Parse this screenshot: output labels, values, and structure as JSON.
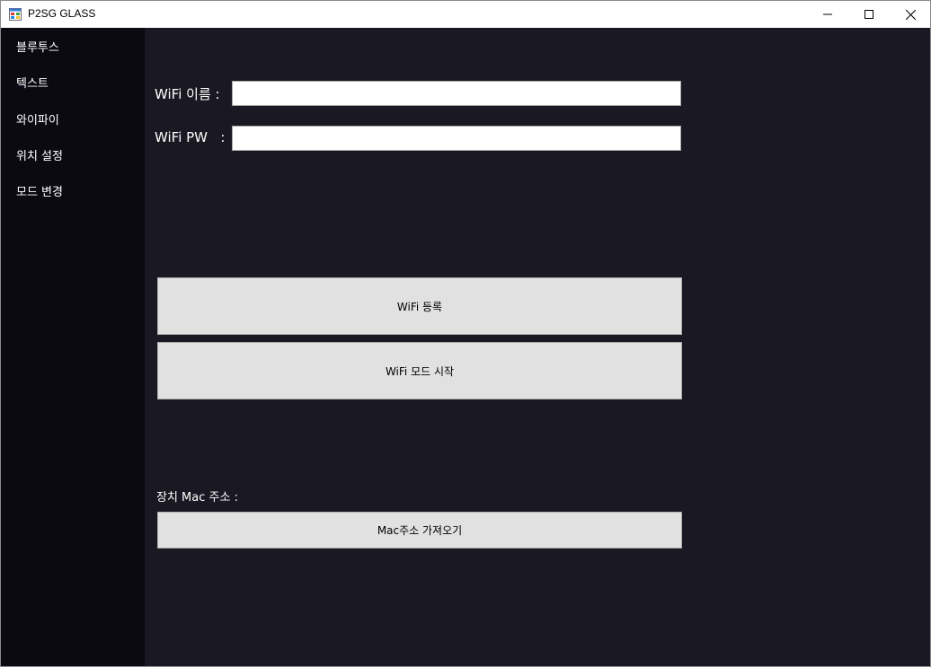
{
  "window": {
    "title": "P2SG GLASS",
    "icon": "app-window-icon",
    "controls": [
      "minimize-icon",
      "maximize-icon",
      "close-icon"
    ]
  },
  "sidebar": {
    "items": [
      {
        "label": "블루투스"
      },
      {
        "label": "텍스트"
      },
      {
        "label": "와이파이"
      },
      {
        "label": "위치 설정"
      },
      {
        "label": "모드 변경"
      }
    ]
  },
  "wifi": {
    "name_label": "WiFi 이름 :",
    "name_value": "",
    "pw_label": "WiFi PW   :",
    "pw_value": "",
    "register_button": "WiFi 등록",
    "start_button": "WiFi 모드 시작"
  },
  "mac": {
    "label": "장치 Mac 주소 :",
    "fetch_button": "Mac주소 가져오기"
  },
  "colors": {
    "sidebar_bg": "#0b0a12",
    "main_bg": "#1a1822",
    "button_bg": "#e1e1e1",
    "text_light": "#ffffff"
  }
}
